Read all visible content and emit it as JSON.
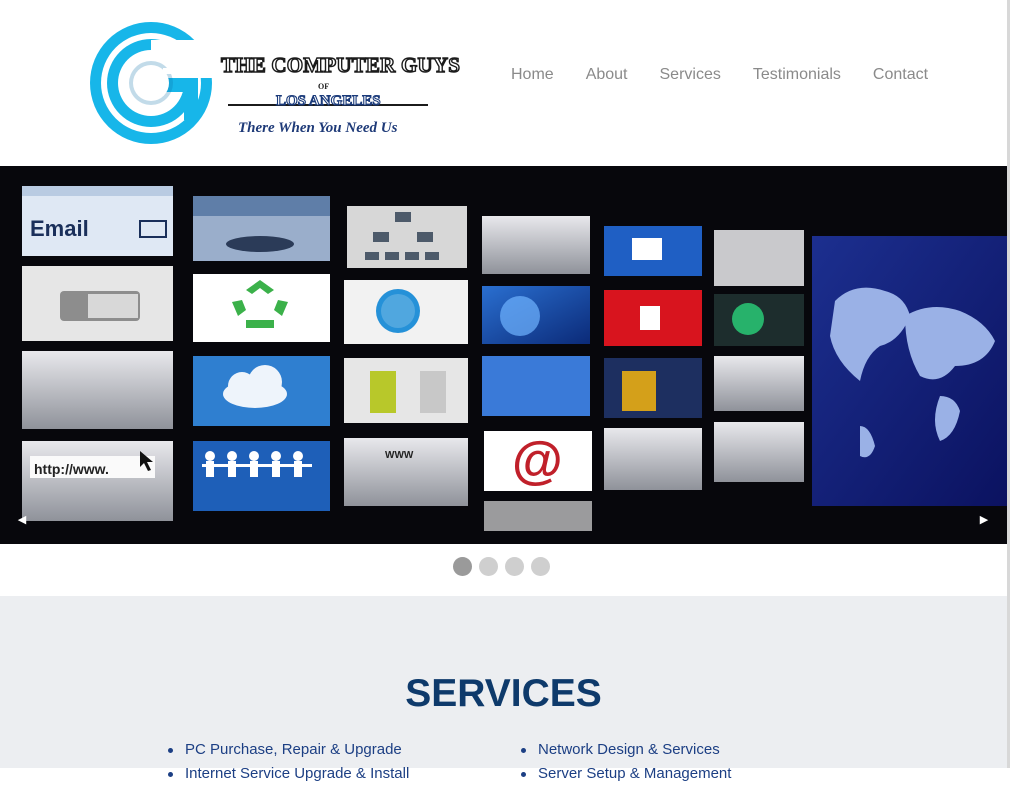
{
  "logo": {
    "title": "THE COMPUTER GUYS",
    "of": "OF",
    "subtitle": "LOS ANGELES",
    "tagline": "There When You Need Us",
    "colors": {
      "ring": "#17b6e9",
      "ring_dark": "#0b6fa8",
      "text_outline": "#1b1b1b",
      "tagline": "#1e3a78"
    }
  },
  "nav": {
    "items": [
      "Home",
      "About",
      "Services",
      "Testimonials",
      "Contact"
    ]
  },
  "slider": {
    "tiles": {
      "email": "Email",
      "url": "http://www.",
      "at_sign": "@",
      "key": "WWW"
    },
    "prev_icon": "arrow-left-icon",
    "next_icon": "arrow-right-icon",
    "slide_count": 4,
    "active_slide": 1
  },
  "services": {
    "heading": "SERVICES",
    "left": [
      "PC Purchase, Repair & Upgrade",
      "Internet Service Upgrade & Install"
    ],
    "right": [
      "Network Design & Services",
      "Server Setup & Management"
    ]
  },
  "colors": {
    "nav_text": "#8a8a8a",
    "services_bg": "#eceef1",
    "heading": "#0e3a6b",
    "list_text": "#1c3f84"
  }
}
